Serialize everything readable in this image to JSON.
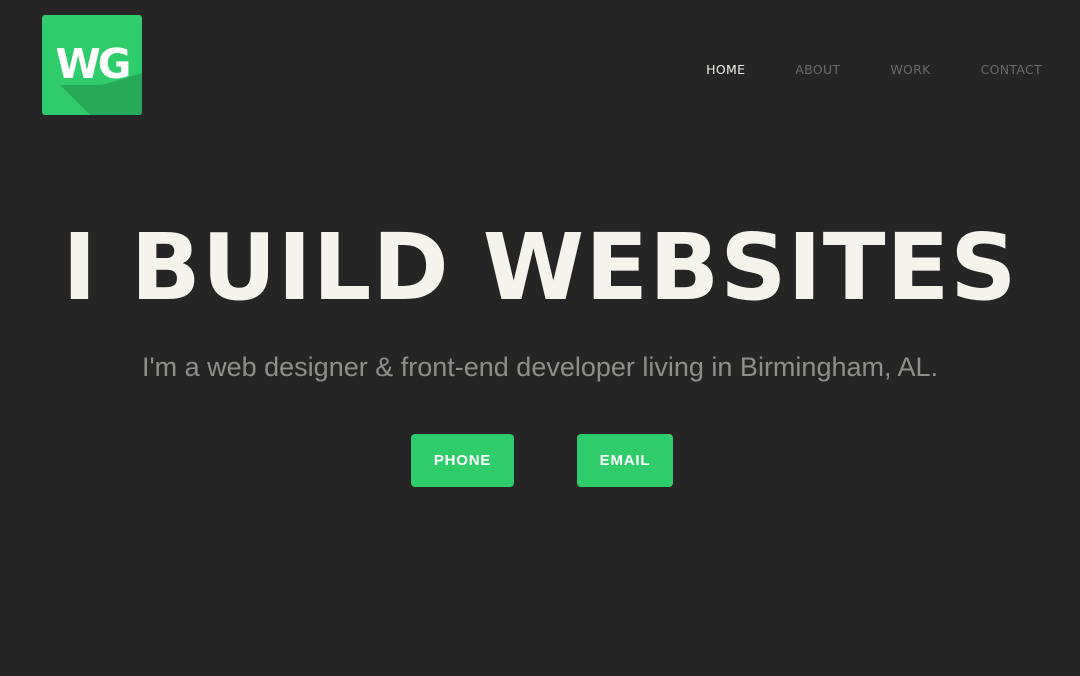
{
  "brand": {
    "logo_text": "WG",
    "logo_color": "#2ecc6b",
    "logo_shadow_color": "#27a95a"
  },
  "nav": {
    "items": [
      {
        "label": "HOME",
        "active": true
      },
      {
        "label": "ABOUT",
        "active": false
      },
      {
        "label": "WORK",
        "active": false
      },
      {
        "label": "CONTACT",
        "active": false
      }
    ]
  },
  "hero": {
    "headline": "I BUILD WEBSITES",
    "tagline": "I'm a web designer & front-end developer living in Birmingham, AL."
  },
  "actions": {
    "phone_label": "PHONE",
    "email_label": "EMAIL"
  },
  "colors": {
    "background": "#252525",
    "accent": "#2ecc6b",
    "headline": "#f4f3ec",
    "tagline": "#8e8e8a",
    "nav_active": "#f0f0ea",
    "nav_inactive": "#6a6a6a"
  }
}
